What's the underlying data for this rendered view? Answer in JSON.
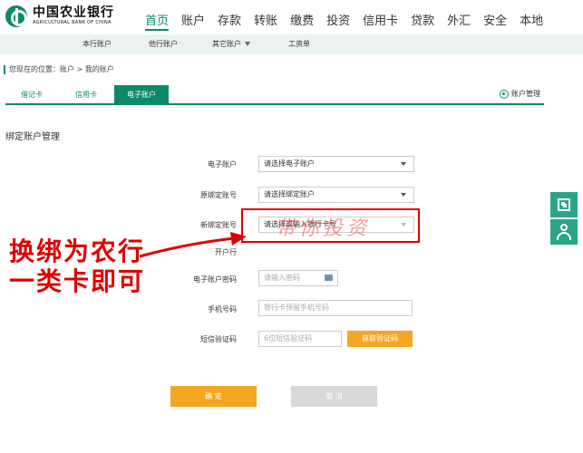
{
  "bank": {
    "name_cn": "中国农业银行",
    "name_en": "AGRICULTURAL BANK OF CHINA"
  },
  "nav": {
    "items": [
      {
        "label": "首页"
      },
      {
        "label": "账户"
      },
      {
        "label": "存款"
      },
      {
        "label": "转账"
      },
      {
        "label": "缴费"
      },
      {
        "label": "投资"
      },
      {
        "label": "信用卡"
      },
      {
        "label": "贷款"
      },
      {
        "label": "外汇"
      },
      {
        "label": "安全"
      },
      {
        "label": "本地"
      }
    ],
    "active": "首页"
  },
  "subnav": {
    "items": [
      {
        "label": "本行账户"
      },
      {
        "label": "他行账户"
      },
      {
        "label": "其它账户"
      },
      {
        "label": "工资单"
      }
    ]
  },
  "breadcrumb": "您现在的位置：账户 > 我的账户",
  "tabs": {
    "items": [
      {
        "label": "借记卡"
      },
      {
        "label": "信用卡"
      },
      {
        "label": "电子账户"
      }
    ],
    "active": "电子账户",
    "manage_label": "账户管理"
  },
  "section_title": "绑定账户管理",
  "form": {
    "e_account": {
      "label": "电子账户",
      "value": "请选择电子账户"
    },
    "old_bound": {
      "label": "原绑定账号",
      "value": "请选择绑定账户"
    },
    "new_bound": {
      "label": "新绑定账号",
      "value": "请选择或输入银行卡号"
    },
    "open_bank": {
      "label": "开户行"
    },
    "password": {
      "label": "电子账户密码",
      "placeholder": "请输入密码"
    },
    "phone": {
      "label": "手机号码",
      "placeholder": "银行卡预留手机号码"
    },
    "sms": {
      "label": "短信验证码",
      "placeholder": "6位短信验证码",
      "button": "获取验证码"
    }
  },
  "buttons": {
    "confirm": "确 定",
    "cancel": "取 消"
  },
  "annotation": {
    "line1": "换绑为农行",
    "line2": "一类卡即可",
    "watermark": "带你投资"
  },
  "colors": {
    "brand": "#0b8a6b",
    "accent": "#f5a623",
    "annotation": "#e00000"
  }
}
